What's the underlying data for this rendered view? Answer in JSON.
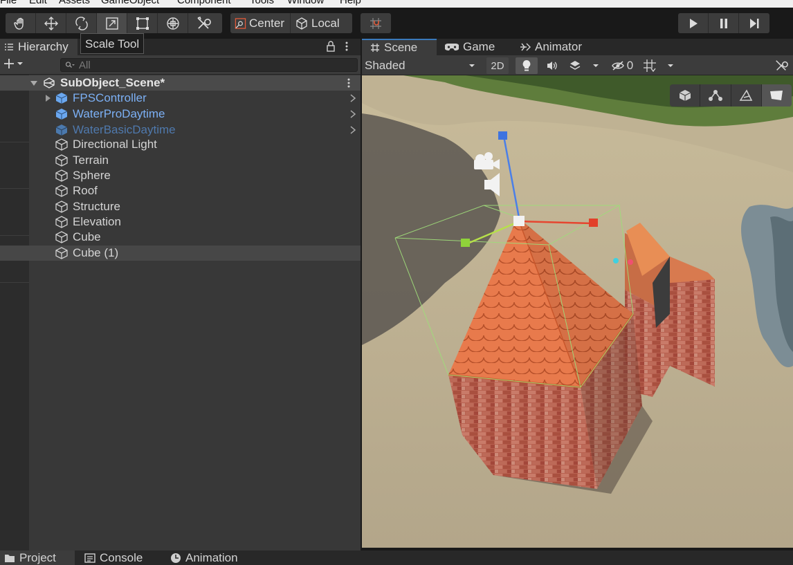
{
  "menu": [
    "File",
    "Edit",
    "Assets",
    "GameObject",
    "Component",
    "Tools",
    "Window",
    "Help"
  ],
  "toolbar": {
    "tools": [
      "hand-tool",
      "move-tool",
      "rotate-tool",
      "scale-tool",
      "rect-tool",
      "transform-tool",
      "custom-tool"
    ],
    "selected_tool": "scale-tool",
    "pivot_label": "Center",
    "space_label": "Local",
    "tooltip": "Scale Tool"
  },
  "hierarchy": {
    "tab_label": "Hierarchy",
    "search_placeholder": "All",
    "scene_name": "SubObject_Scene*",
    "items": [
      {
        "label": "FPSController",
        "style": "prefab",
        "expandable": true
      },
      {
        "label": "WaterProDaytime",
        "style": "prefab",
        "expandable": false
      },
      {
        "label": "WaterBasicDaytime",
        "style": "prefab-inactive",
        "expandable": false
      },
      {
        "label": "Directional Light",
        "style": "object"
      },
      {
        "label": "Terrain",
        "style": "object"
      },
      {
        "label": "Sphere",
        "style": "object"
      },
      {
        "label": "Roof",
        "style": "object"
      },
      {
        "label": "Structure",
        "style": "object"
      },
      {
        "label": "Elevation",
        "style": "object"
      },
      {
        "label": "Cube",
        "style": "object"
      },
      {
        "label": "Cube (1)",
        "style": "object-selected"
      }
    ]
  },
  "scene_panel": {
    "tabs": [
      "Scene",
      "Game",
      "Animator"
    ],
    "active_tab": "Scene",
    "shading_mode": "Shaded",
    "mode_2d": "2D",
    "hidden_count": "0"
  },
  "bottom_tabs": [
    "Project",
    "Console",
    "Animation"
  ],
  "colors": {
    "accent": "#3a79bb",
    "prefab": "#7cb0f5",
    "prefab_inactive": "#4f79ad",
    "panel": "#383838"
  }
}
